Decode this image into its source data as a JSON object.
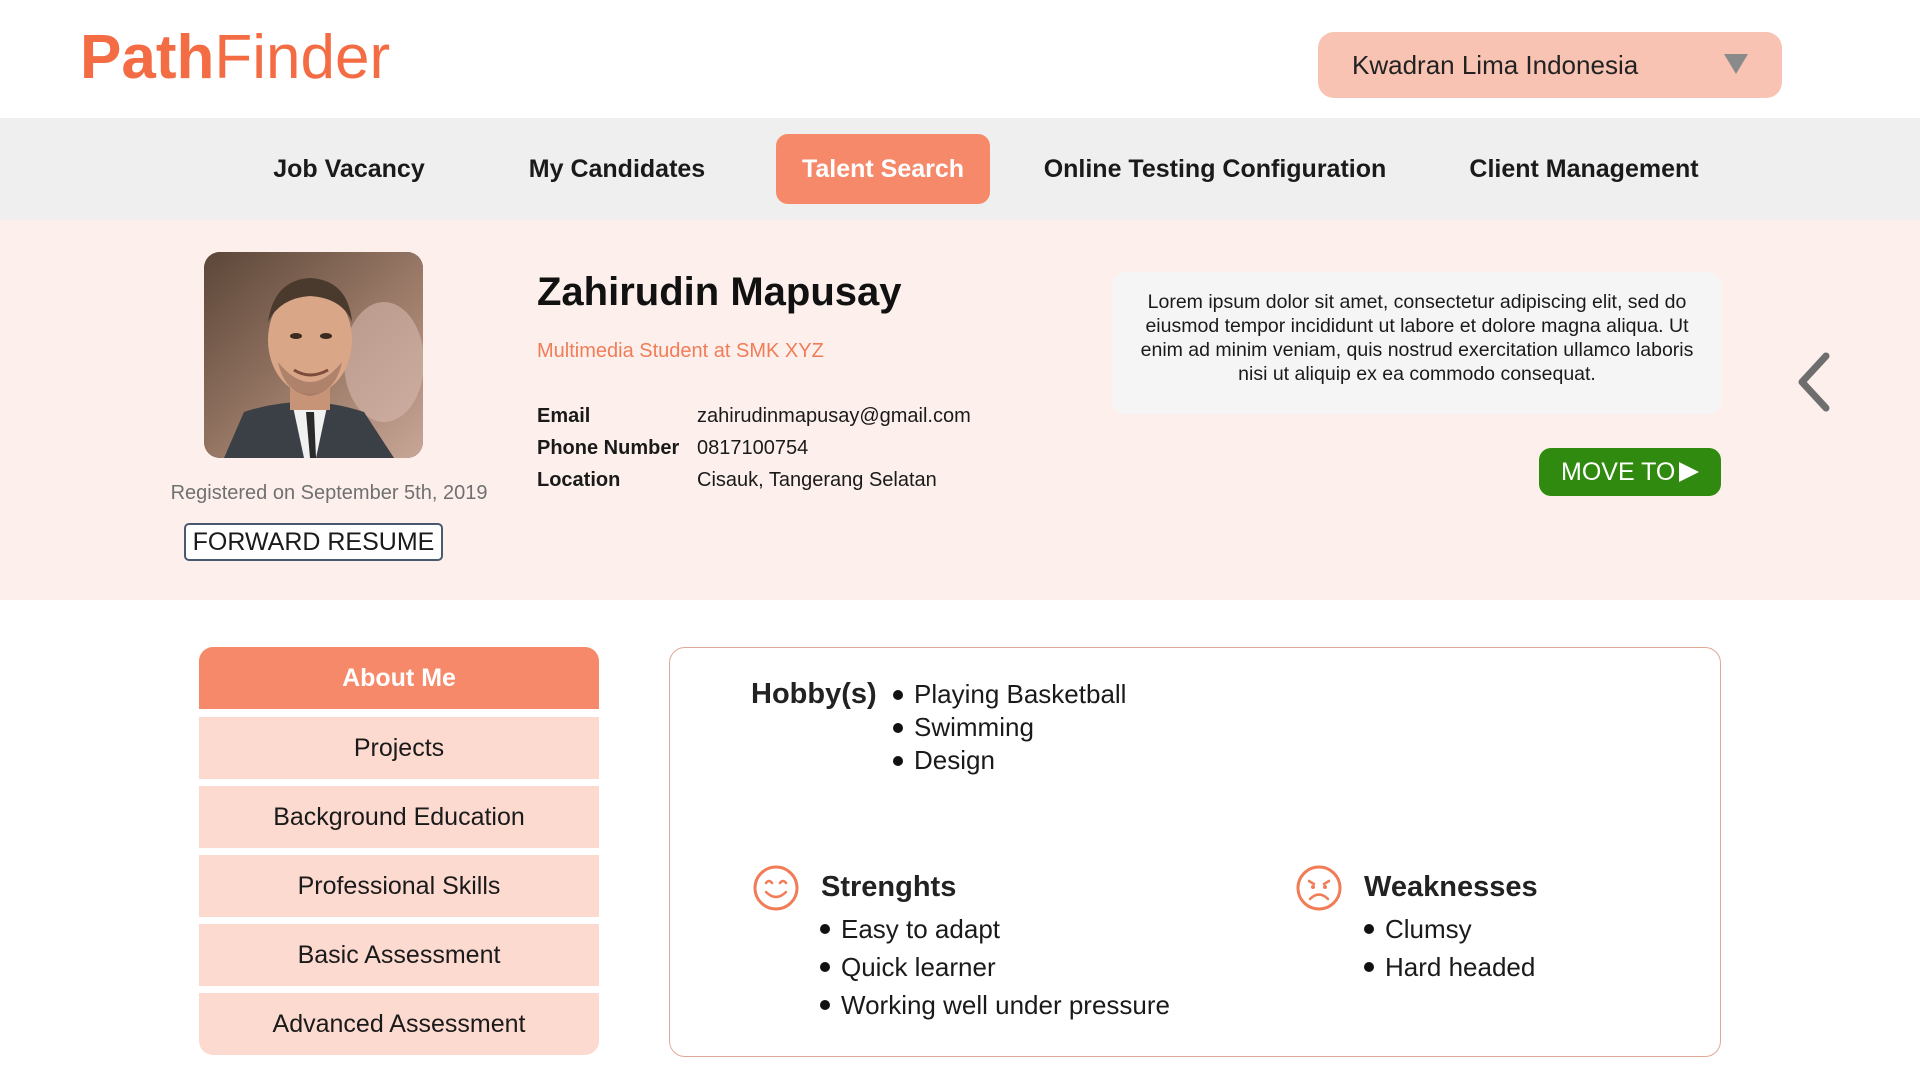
{
  "brand": {
    "part1": "Path",
    "part2": "Finder",
    "color": "#f36c43"
  },
  "company_select": {
    "value": "Kwadran Lima Indonesia"
  },
  "nav": {
    "items": [
      {
        "label": "Job Vacancy"
      },
      {
        "label": "My Candidates"
      },
      {
        "label": "Talent Search",
        "active": true
      },
      {
        "label": "Online Testing Configuration"
      },
      {
        "label": "Client Management"
      }
    ]
  },
  "profile": {
    "name": "Zahirudin Mapusay",
    "subtitle": "Multimedia Student at SMK XYZ",
    "registered": "Registered on September 5th, 2019",
    "forward_label": "FORWARD RESUME",
    "fields": [
      {
        "label": "Email",
        "value": "zahirudinmapusay@gmail.com"
      },
      {
        "label": "Phone Number",
        "value": "0817100754"
      },
      {
        "label": "Location",
        "value": "Cisauk, Tangerang Selatan"
      }
    ],
    "about": "Lorem ipsum dolor sit amet, consectetur adipiscing elit, sed do eiusmod tempor incididunt ut labore et dolore magna aliqua. Ut enim ad minim veniam, quis nostrud exercitation ullamco laboris nisi ut aliquip ex ea commodo consequat.",
    "move_label": "MOVE TO"
  },
  "side_menu": {
    "items": [
      {
        "label": "About Me",
        "active": true
      },
      {
        "label": "Projects"
      },
      {
        "label": "Background Education"
      },
      {
        "label": "Professional Skills"
      },
      {
        "label": "Basic Assessment"
      },
      {
        "label": "Advanced Assessment"
      }
    ]
  },
  "details": {
    "hobby_title": "Hobby(s)",
    "hobbies": [
      "Playing Basketball",
      "Swimming",
      "Design"
    ],
    "strengths_title": "Strenghts",
    "strengths": [
      "Easy to adapt",
      "Quick learner",
      "Working well under pressure"
    ],
    "weaknesses_title": "Weaknesses",
    "weaknesses": [
      "Clumsy",
      "Hard headed"
    ]
  },
  "colors": {
    "accent": "#f6896a",
    "accent_light": "#fcdad0",
    "band_bg": "#fdf0ec",
    "move_button": "#2f8a0f"
  },
  "icons": {
    "dropdown": "caret-down-icon",
    "back": "chevron-left-icon",
    "move": "play-icon",
    "strengths": "smile-face-icon",
    "weaknesses": "sad-face-icon"
  }
}
